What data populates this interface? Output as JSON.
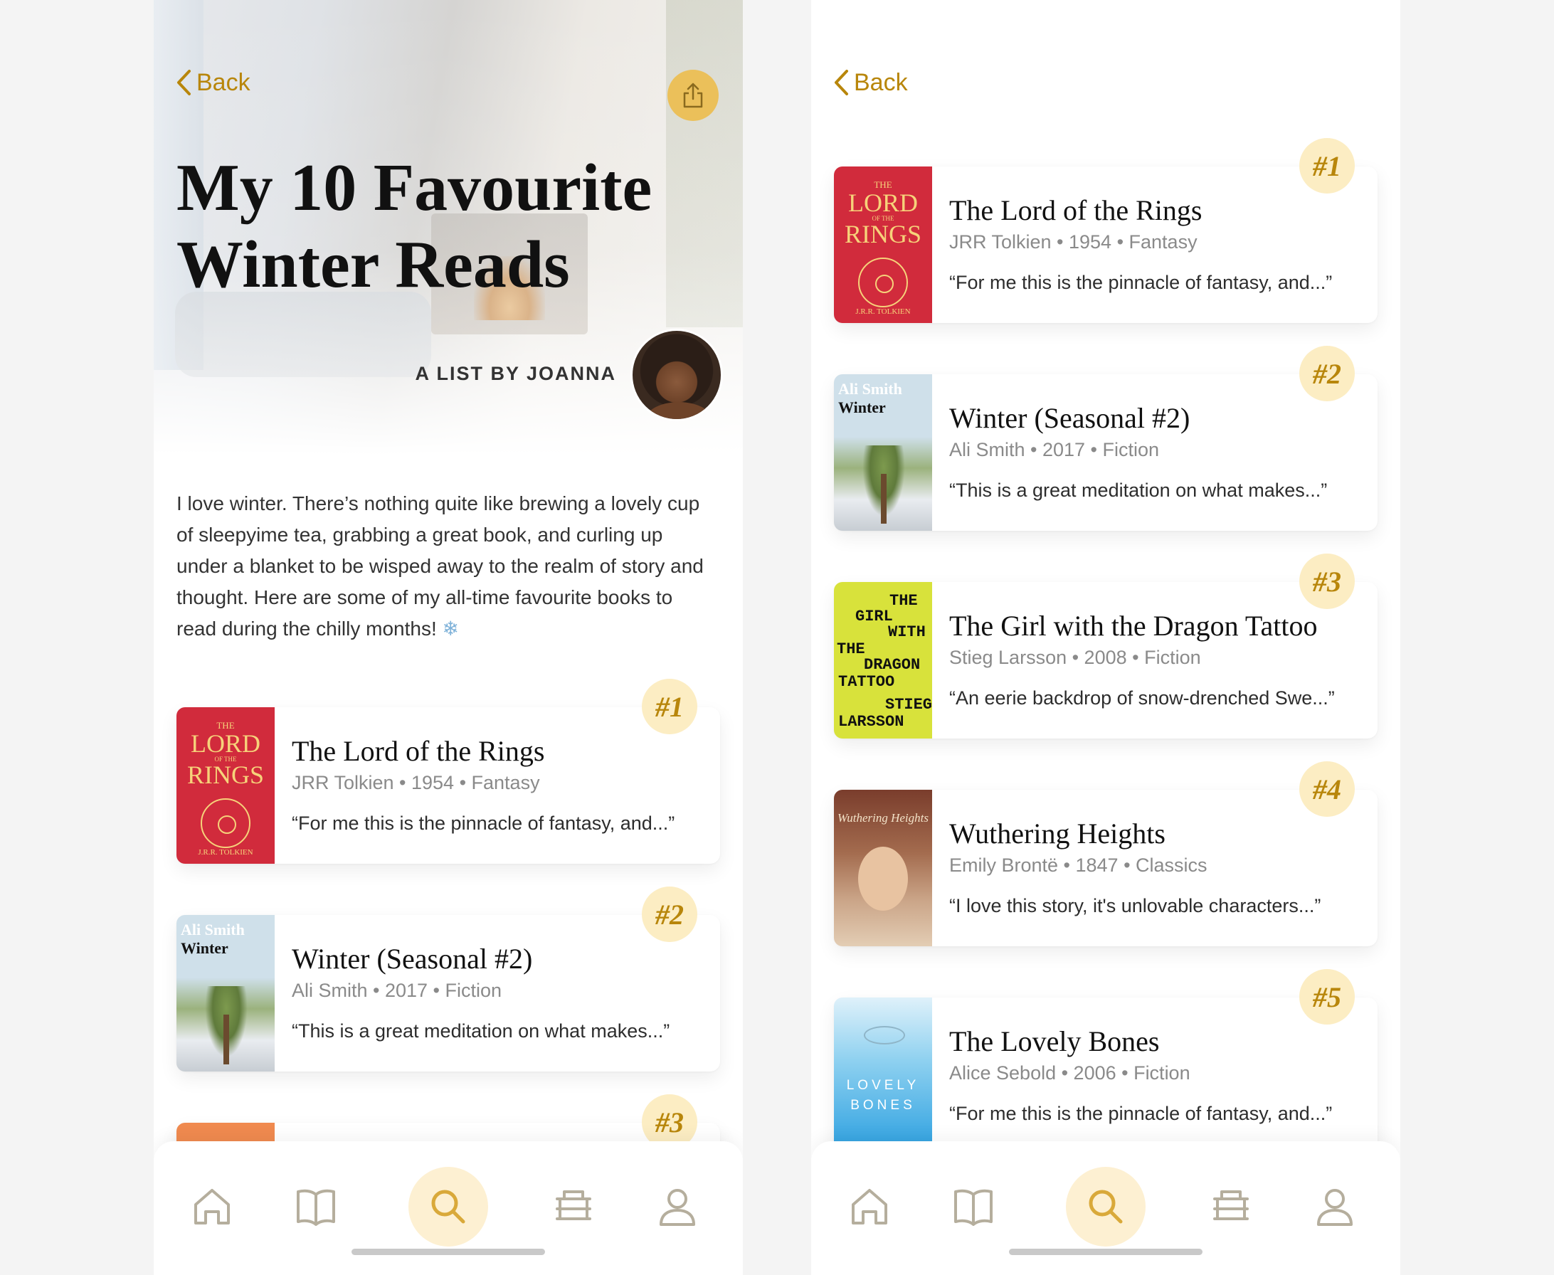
{
  "left": {
    "back_label": "Back",
    "title": "My 10 Favourite\nWinter Reads",
    "byline": "A LIST BY JOANNA",
    "intro": "I love winter. There’s nothing quite like brewing a lovely cup of sleepyime tea, grabbing a great book, and curling up under a blanket to be wisped away to the realm of story and thought. Here are some of my all-time favourite books to read during the chilly months!",
    "intro_emoji": "❄",
    "partial_rank": "#3"
  },
  "right": {
    "back_label": "Back"
  },
  "books": [
    {
      "rank": "#1",
      "title": "The Lord of the Rings",
      "meta": "JRR Tolkien • 1954 • Fantasy",
      "quote": "“For me this is the pinnacle of fantasy, and...”"
    },
    {
      "rank": "#2",
      "title": "Winter (Seasonal #2)",
      "meta": "Ali Smith • 2017 • Fiction",
      "quote": "“This is a great meditation on what makes...”"
    },
    {
      "rank": "#3",
      "title": "The Girl with the Dragon Tattoo",
      "meta": "Stieg Larsson • 2008 • Fiction",
      "quote": "“An eerie backdrop of snow-drenched Swe...”"
    },
    {
      "rank": "#4",
      "title": "Wuthering Heights",
      "meta": "Emily Brontë • 1847 • Classics",
      "quote": "“I love this story, it's unlovable characters...”"
    },
    {
      "rank": "#5",
      "title": "The Lovely Bones",
      "meta": "Alice Sebold • 2006 • Fiction",
      "quote": "“For me this is the pinnacle of fantasy, and...”"
    }
  ],
  "covers": {
    "lotr": {
      "top": "THE",
      "line1": "LORD",
      "mid": "OF THE",
      "line2": "RINGS",
      "author": "J.R.R. TOLKIEN"
    },
    "winter": {
      "author": "Ali Smith",
      "title": "Winter"
    },
    "dragon": {
      "l1": "THE",
      "l2": "GIRL",
      "l3": "WITH",
      "l4": "THE",
      "l5": "DRAGON",
      "l6": "TATTOO",
      "l7": "STIEG",
      "l8": "LARSSON"
    },
    "wuthering": {
      "title": "Wuthering Heights"
    },
    "bones": {
      "l1": "LOVELY",
      "l2": "BONES"
    }
  },
  "tabs": [
    {
      "name": "home-icon",
      "active": false
    },
    {
      "name": "book-icon",
      "active": false
    },
    {
      "name": "search-icon",
      "active": true
    },
    {
      "name": "books-stack-icon",
      "active": false
    },
    {
      "name": "profile-icon",
      "active": false
    }
  ],
  "colors": {
    "accent": "#b8860b",
    "rank_bg": "#fcedc3",
    "share_bg": "#ebc05a",
    "tab_icon": "#b5ae9d",
    "tab_active": "#d9a93a"
  }
}
